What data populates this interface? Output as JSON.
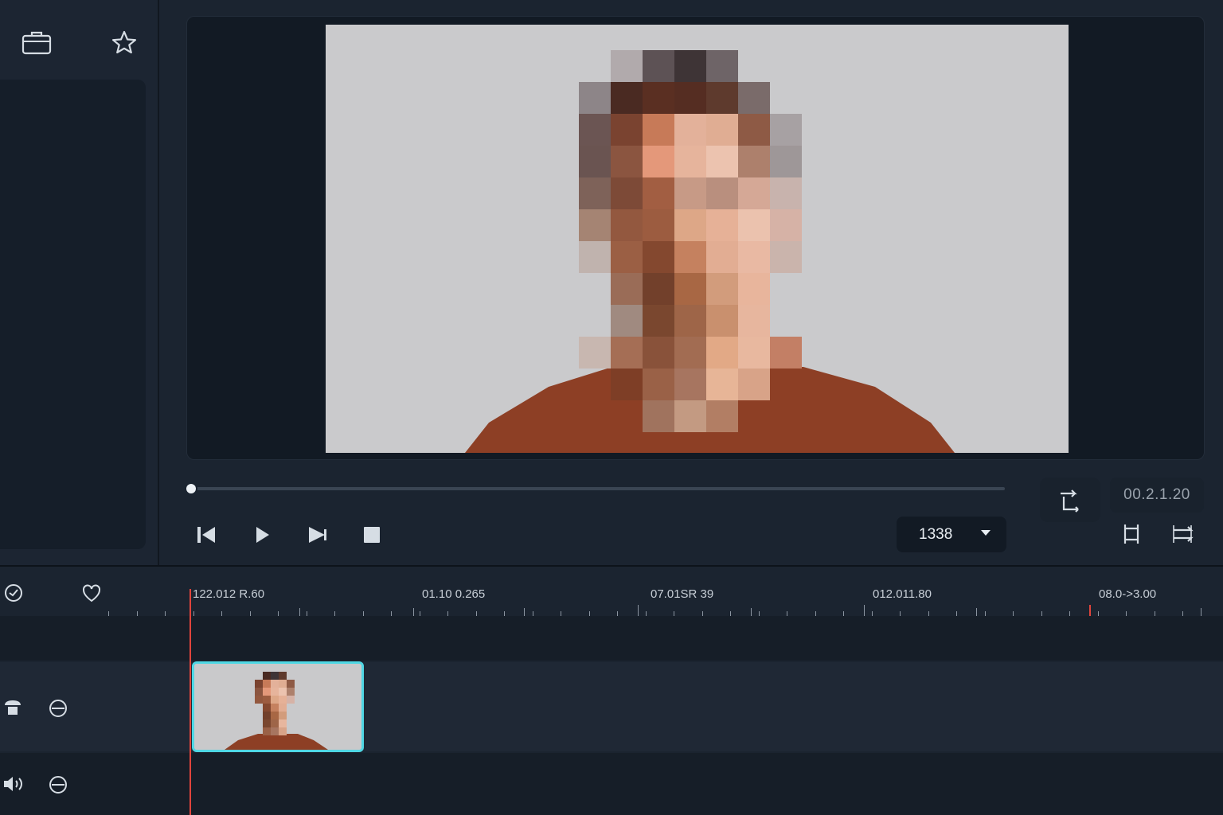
{
  "sidebar": {
    "media_icon": "briefcase-icon",
    "favorite_icon": "star-icon"
  },
  "player": {
    "progress": 0.0,
    "controls": [
      "step-back-icon",
      "play-icon",
      "step-forward-icon",
      "stop-icon"
    ],
    "resolution_value": "1338",
    "timecode": "00.2.1.20"
  },
  "timeline": {
    "ruler_labels": [
      "122.012 R.60",
      "01.10 0.265",
      "07.01SR 39",
      "012.011.80",
      "08.0->3.00"
    ],
    "tracks": [
      {
        "name": "video-track",
        "icons": [
          "hat-icon",
          "visibility-icon"
        ]
      },
      {
        "name": "audio-track",
        "icons": [
          "speaker-icon",
          "visibility-icon"
        ]
      }
    ]
  },
  "colors": {
    "background": "#1b2430",
    "panel": "#121a24",
    "clip_border": "#4fd7e4",
    "playhead": "#e0443c"
  }
}
